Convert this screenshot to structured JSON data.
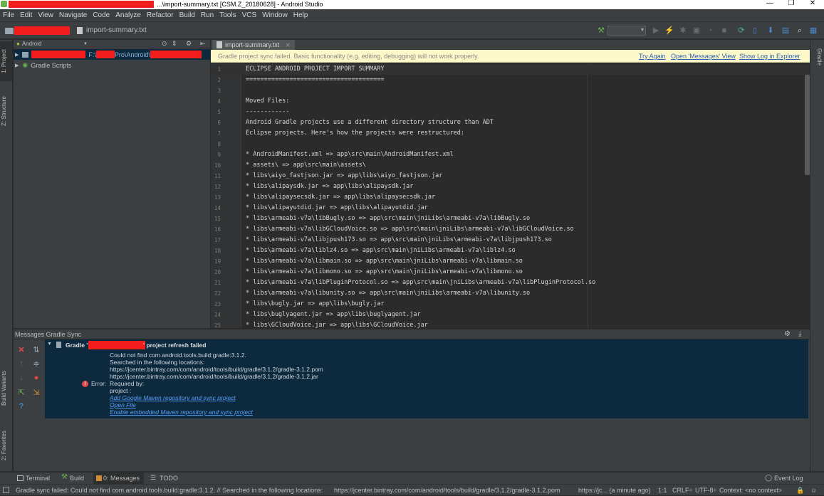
{
  "window": {
    "title": "...\\import-summary.txt [CSM.Z_20180628] - Android Studio",
    "controls": [
      "—",
      "❐",
      "✕"
    ]
  },
  "menu": [
    "File",
    "Edit",
    "View",
    "Navigate",
    "Code",
    "Analyze",
    "Refactor",
    "Build",
    "Run",
    "Tools",
    "VCS",
    "Window",
    "Help"
  ],
  "navbar": {
    "file_crumb": "import-summary.txt"
  },
  "left_tool_tabs": {
    "project": "1: Project",
    "structure": "Z: Structure",
    "build_variants": "Build Variants",
    "favorites": "2: Favorites"
  },
  "right_tool_tabs": {
    "gradle": "Gradle"
  },
  "project_panel": {
    "view_mode": "Android",
    "tree": [
      {
        "label_prefix": "F:\\",
        "label_mid": "Pro\\Android\\",
        "redacted": true
      },
      {
        "label": "Gradle Scripts"
      }
    ]
  },
  "editor": {
    "tab": "import-summary.txt",
    "sync_notice": "Gradle project sync failed. Basic functionality (e.g. editing, debugging) will not work properly.",
    "sync_actions": [
      "Try Again",
      "Open 'Messages' View",
      "Show Log in Explorer"
    ],
    "lines": [
      "ECLIPSE ANDROID PROJECT IMPORT SUMMARY",
      "======================================",
      "",
      "Moved Files:",
      "------------",
      "Android Gradle projects use a different directory structure than ADT",
      "Eclipse projects. Here's how the projects were restructured:",
      "",
      "* AndroidManifest.xml => app\\src\\main\\AndroidManifest.xml",
      "* assets\\ => app\\src\\main\\assets\\",
      "* libs\\aiyo_fastjson.jar => app\\libs\\aiyo_fastjson.jar",
      "* libs\\alipaysdk.jar => app\\libs\\alipaysdk.jar",
      "* libs\\alipaysecsdk.jar => app\\libs\\alipaysecsdk.jar",
      "* libs\\alipayutdid.jar => app\\libs\\alipayutdid.jar",
      "* libs\\armeabi-v7a\\libBugly.so => app\\src\\main\\jniLibs\\armeabi-v7a\\libBugly.so",
      "* libs\\armeabi-v7a\\libGCloudVoice.so => app\\src\\main\\jniLibs\\armeabi-v7a\\libGCloudVoice.so",
      "* libs\\armeabi-v7a\\libjpush173.so => app\\src\\main\\jniLibs\\armeabi-v7a\\libjpush173.so",
      "* libs\\armeabi-v7a\\liblz4.so => app\\src\\main\\jniLibs\\armeabi-v7a\\liblz4.so",
      "* libs\\armeabi-v7a\\libmain.so => app\\src\\main\\jniLibs\\armeabi-v7a\\libmain.so",
      "* libs\\armeabi-v7a\\libmono.so => app\\src\\main\\jniLibs\\armeabi-v7a\\libmono.so",
      "* libs\\armeabi-v7a\\libPluginProtocol.so => app\\src\\main\\jniLibs\\armeabi-v7a\\libPluginProtocol.so",
      "* libs\\armeabi-v7a\\libunity.so => app\\src\\main\\jniLibs\\armeabi-v7a\\libunity.so",
      "* libs\\bugly.jar => app\\libs\\bugly.jar",
      "* libs\\buglyagent.jar => app\\libs\\buglyagent.jar",
      "* libs\\GCloudVoice.jar => app\\libs\\GCloudVoice.jar"
    ]
  },
  "messages": {
    "title": "Messages Gradle Sync",
    "group_prefix": "Gradle '",
    "group_suffix": "' project refresh failed",
    "error_label": "Error:",
    "lines": [
      "Could not find com.android.tools.build:gradle:3.1.2.",
      "Searched in the following locations:",
      "https://jcenter.bintray.com/com/android/tools/build/gradle/3.1.2/gradle-3.1.2.pom",
      "https://jcenter.bintray.com/com/android/tools/build/gradle/3.1.2/gradle-3.1.2.jar",
      "Required by:",
      "project :"
    ],
    "links": [
      "Add Google Maven repository and sync project",
      "Open File",
      "Enable embedded Maven repository and sync project"
    ]
  },
  "bottom_tabs": {
    "terminal": "Terminal",
    "build": "Build",
    "messages": "0: Messages",
    "todo": "TODO",
    "event_log": "Event Log"
  },
  "status": {
    "message": "Gradle sync failed: Could not find com.android.tools.build:gradle:3.1.2. // Searched in the following locations:",
    "url": "https://jcenter.bintray.com/com/android/tools/build/gradle/3.1.2/gradle-3.1.2.pom",
    "tail": "https://jc... (a minute ago)",
    "position": "1:1",
    "line_sep": "CRLF÷",
    "encoding": "UTF-8÷",
    "context": "Context: <no context>"
  },
  "colors": {
    "accent_error": "#e24a4a",
    "link": "#589df6",
    "redaction": "#f21d1d",
    "notice_bg": "#fcf8c7"
  }
}
